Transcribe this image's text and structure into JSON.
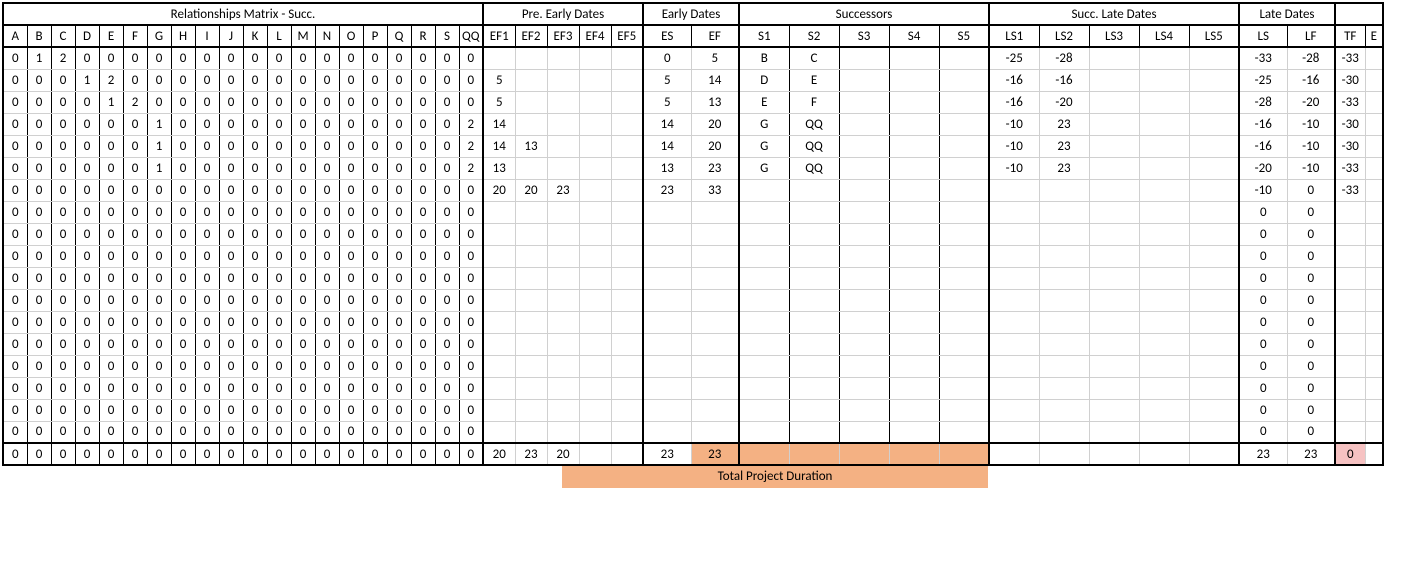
{
  "groups": {
    "matrix": "Relationships Matrix - Succ.",
    "preEarly": "Pre. Early Dates",
    "earlyDates": "Early Dates",
    "successors": "Successors",
    "succLate": "Succ. Late Dates",
    "lateDates": "Late Dates"
  },
  "matrixHeaders": [
    "A",
    "B",
    "C",
    "D",
    "E",
    "F",
    "G",
    "H",
    "I",
    "J",
    "K",
    "L",
    "M",
    "N",
    "O",
    "P",
    "Q",
    "R",
    "S",
    "QQ"
  ],
  "efHeaders": [
    "EF1",
    "EF2",
    "EF3",
    "EF4",
    "EF5"
  ],
  "edHeaders": [
    "ES",
    "EF"
  ],
  "succHeaders": [
    "S1",
    "S2",
    "S3",
    "S4",
    "S5"
  ],
  "slHeaders": [
    "LS1",
    "LS2",
    "LS3",
    "LS4",
    "LS5"
  ],
  "lateHeaders": [
    "LS",
    "LF"
  ],
  "tfHeader": "TF",
  "extraHeader": "E",
  "rows": [
    {
      "m": [
        0,
        1,
        2,
        0,
        0,
        0,
        0,
        0,
        0,
        0,
        0,
        0,
        0,
        0,
        0,
        0,
        0,
        0,
        0,
        0
      ],
      "ef": [
        "",
        "",
        "",
        "",
        ""
      ],
      "ed": [
        "0",
        "5"
      ],
      "s": [
        "B",
        "C",
        "",
        "",
        ""
      ],
      "sl": [
        "-25",
        "-28",
        "",
        "",
        ""
      ],
      "ld": [
        "-33",
        "-28"
      ],
      "tf": "-33"
    },
    {
      "m": [
        0,
        0,
        0,
        1,
        2,
        0,
        0,
        0,
        0,
        0,
        0,
        0,
        0,
        0,
        0,
        0,
        0,
        0,
        0,
        0
      ],
      "ef": [
        "5",
        "",
        "",
        "",
        ""
      ],
      "ed": [
        "5",
        "14"
      ],
      "s": [
        "D",
        "E",
        "",
        "",
        ""
      ],
      "sl": [
        "-16",
        "-16",
        "",
        "",
        ""
      ],
      "ld": [
        "-25",
        "-16"
      ],
      "tf": "-30"
    },
    {
      "m": [
        0,
        0,
        0,
        0,
        1,
        2,
        0,
        0,
        0,
        0,
        0,
        0,
        0,
        0,
        0,
        0,
        0,
        0,
        0,
        0
      ],
      "ef": [
        "5",
        "",
        "",
        "",
        ""
      ],
      "ed": [
        "5",
        "13"
      ],
      "s": [
        "E",
        "F",
        "",
        "",
        ""
      ],
      "sl": [
        "-16",
        "-20",
        "",
        "",
        ""
      ],
      "ld": [
        "-28",
        "-20"
      ],
      "tf": "-33"
    },
    {
      "m": [
        0,
        0,
        0,
        0,
        0,
        0,
        1,
        0,
        0,
        0,
        0,
        0,
        0,
        0,
        0,
        0,
        0,
        0,
        0,
        2
      ],
      "ef": [
        "14",
        "",
        "",
        "",
        ""
      ],
      "ed": [
        "14",
        "20"
      ],
      "s": [
        "G",
        "QQ",
        "",
        "",
        ""
      ],
      "sl": [
        "-10",
        "23",
        "",
        "",
        ""
      ],
      "ld": [
        "-16",
        "-10"
      ],
      "tf": "-30"
    },
    {
      "m": [
        0,
        0,
        0,
        0,
        0,
        0,
        1,
        0,
        0,
        0,
        0,
        0,
        0,
        0,
        0,
        0,
        0,
        0,
        0,
        2
      ],
      "ef": [
        "14",
        "13",
        "",
        "",
        ""
      ],
      "ed": [
        "14",
        "20"
      ],
      "s": [
        "G",
        "QQ",
        "",
        "",
        ""
      ],
      "sl": [
        "-10",
        "23",
        "",
        "",
        ""
      ],
      "ld": [
        "-16",
        "-10"
      ],
      "tf": "-30"
    },
    {
      "m": [
        0,
        0,
        0,
        0,
        0,
        0,
        1,
        0,
        0,
        0,
        0,
        0,
        0,
        0,
        0,
        0,
        0,
        0,
        0,
        2
      ],
      "ef": [
        "13",
        "",
        "",
        "",
        ""
      ],
      "ed": [
        "13",
        "23"
      ],
      "s": [
        "G",
        "QQ",
        "",
        "",
        ""
      ],
      "sl": [
        "-10",
        "23",
        "",
        "",
        ""
      ],
      "ld": [
        "-20",
        "-10"
      ],
      "tf": "-33"
    },
    {
      "m": [
        0,
        0,
        0,
        0,
        0,
        0,
        0,
        0,
        0,
        0,
        0,
        0,
        0,
        0,
        0,
        0,
        0,
        0,
        0,
        0
      ],
      "ef": [
        "20",
        "20",
        "23",
        "",
        ""
      ],
      "ed": [
        "23",
        "33"
      ],
      "s": [
        "",
        "",
        "",
        "",
        ""
      ],
      "sl": [
        "",
        "",
        "",
        "",
        ""
      ],
      "ld": [
        "-10",
        "0"
      ],
      "tf": "-33"
    },
    {
      "m": [
        0,
        0,
        0,
        0,
        0,
        0,
        0,
        0,
        0,
        0,
        0,
        0,
        0,
        0,
        0,
        0,
        0,
        0,
        0,
        0
      ],
      "ef": [
        "",
        "",
        "",
        "",
        ""
      ],
      "ed": [
        "",
        ""
      ],
      "s": [
        "",
        "",
        "",
        "",
        ""
      ],
      "sl": [
        "",
        "",
        "",
        "",
        ""
      ],
      "ld": [
        "0",
        "0"
      ],
      "tf": ""
    },
    {
      "m": [
        0,
        0,
        0,
        0,
        0,
        0,
        0,
        0,
        0,
        0,
        0,
        0,
        0,
        0,
        0,
        0,
        0,
        0,
        0,
        0
      ],
      "ef": [
        "",
        "",
        "",
        "",
        ""
      ],
      "ed": [
        "",
        ""
      ],
      "s": [
        "",
        "",
        "",
        "",
        ""
      ],
      "sl": [
        "",
        "",
        "",
        "",
        ""
      ],
      "ld": [
        "0",
        "0"
      ],
      "tf": ""
    },
    {
      "m": [
        0,
        0,
        0,
        0,
        0,
        0,
        0,
        0,
        0,
        0,
        0,
        0,
        0,
        0,
        0,
        0,
        0,
        0,
        0,
        0
      ],
      "ef": [
        "",
        "",
        "",
        "",
        ""
      ],
      "ed": [
        "",
        ""
      ],
      "s": [
        "",
        "",
        "",
        "",
        ""
      ],
      "sl": [
        "",
        "",
        "",
        "",
        ""
      ],
      "ld": [
        "0",
        "0"
      ],
      "tf": ""
    },
    {
      "m": [
        0,
        0,
        0,
        0,
        0,
        0,
        0,
        0,
        0,
        0,
        0,
        0,
        0,
        0,
        0,
        0,
        0,
        0,
        0,
        0
      ],
      "ef": [
        "",
        "",
        "",
        "",
        ""
      ],
      "ed": [
        "",
        ""
      ],
      "s": [
        "",
        "",
        "",
        "",
        ""
      ],
      "sl": [
        "",
        "",
        "",
        "",
        ""
      ],
      "ld": [
        "0",
        "0"
      ],
      "tf": ""
    },
    {
      "m": [
        0,
        0,
        0,
        0,
        0,
        0,
        0,
        0,
        0,
        0,
        0,
        0,
        0,
        0,
        0,
        0,
        0,
        0,
        0,
        0
      ],
      "ef": [
        "",
        "",
        "",
        "",
        ""
      ],
      "ed": [
        "",
        ""
      ],
      "s": [
        "",
        "",
        "",
        "",
        ""
      ],
      "sl": [
        "",
        "",
        "",
        "",
        ""
      ],
      "ld": [
        "0",
        "0"
      ],
      "tf": ""
    },
    {
      "m": [
        0,
        0,
        0,
        0,
        0,
        0,
        0,
        0,
        0,
        0,
        0,
        0,
        0,
        0,
        0,
        0,
        0,
        0,
        0,
        0
      ],
      "ef": [
        "",
        "",
        "",
        "",
        ""
      ],
      "ed": [
        "",
        ""
      ],
      "s": [
        "",
        "",
        "",
        "",
        ""
      ],
      "sl": [
        "",
        "",
        "",
        "",
        ""
      ],
      "ld": [
        "0",
        "0"
      ],
      "tf": ""
    },
    {
      "m": [
        0,
        0,
        0,
        0,
        0,
        0,
        0,
        0,
        0,
        0,
        0,
        0,
        0,
        0,
        0,
        0,
        0,
        0,
        0,
        0
      ],
      "ef": [
        "",
        "",
        "",
        "",
        ""
      ],
      "ed": [
        "",
        ""
      ],
      "s": [
        "",
        "",
        "",
        "",
        ""
      ],
      "sl": [
        "",
        "",
        "",
        "",
        ""
      ],
      "ld": [
        "0",
        "0"
      ],
      "tf": ""
    },
    {
      "m": [
        0,
        0,
        0,
        0,
        0,
        0,
        0,
        0,
        0,
        0,
        0,
        0,
        0,
        0,
        0,
        0,
        0,
        0,
        0,
        0
      ],
      "ef": [
        "",
        "",
        "",
        "",
        ""
      ],
      "ed": [
        "",
        ""
      ],
      "s": [
        "",
        "",
        "",
        "",
        ""
      ],
      "sl": [
        "",
        "",
        "",
        "",
        ""
      ],
      "ld": [
        "0",
        "0"
      ],
      "tf": ""
    },
    {
      "m": [
        0,
        0,
        0,
        0,
        0,
        0,
        0,
        0,
        0,
        0,
        0,
        0,
        0,
        0,
        0,
        0,
        0,
        0,
        0,
        0
      ],
      "ef": [
        "",
        "",
        "",
        "",
        ""
      ],
      "ed": [
        "",
        ""
      ],
      "s": [
        "",
        "",
        "",
        "",
        ""
      ],
      "sl": [
        "",
        "",
        "",
        "",
        ""
      ],
      "ld": [
        "0",
        "0"
      ],
      "tf": ""
    },
    {
      "m": [
        0,
        0,
        0,
        0,
        0,
        0,
        0,
        0,
        0,
        0,
        0,
        0,
        0,
        0,
        0,
        0,
        0,
        0,
        0,
        0
      ],
      "ef": [
        "",
        "",
        "",
        "",
        ""
      ],
      "ed": [
        "",
        ""
      ],
      "s": [
        "",
        "",
        "",
        "",
        ""
      ],
      "sl": [
        "",
        "",
        "",
        "",
        ""
      ],
      "ld": [
        "0",
        "0"
      ],
      "tf": ""
    },
    {
      "m": [
        0,
        0,
        0,
        0,
        0,
        0,
        0,
        0,
        0,
        0,
        0,
        0,
        0,
        0,
        0,
        0,
        0,
        0,
        0,
        0
      ],
      "ef": [
        "",
        "",
        "",
        "",
        ""
      ],
      "ed": [
        "",
        ""
      ],
      "s": [
        "",
        "",
        "",
        "",
        ""
      ],
      "sl": [
        "",
        "",
        "",
        "",
        ""
      ],
      "ld": [
        "0",
        "0"
      ],
      "tf": ""
    }
  ],
  "footer": {
    "m": [
      0,
      0,
      0,
      0,
      0,
      0,
      0,
      0,
      0,
      0,
      0,
      0,
      0,
      0,
      0,
      0,
      0,
      0,
      0,
      0
    ],
    "ef": [
      "20",
      "23",
      "20",
      "",
      ""
    ],
    "ed": [
      "23",
      "23"
    ],
    "s": [
      "",
      "",
      "",
      "",
      ""
    ],
    "sl": [
      "",
      "",
      "",
      "",
      ""
    ],
    "ld": [
      "23",
      "23"
    ],
    "tf": "0"
  },
  "durationLabel": "Total Project Duration"
}
